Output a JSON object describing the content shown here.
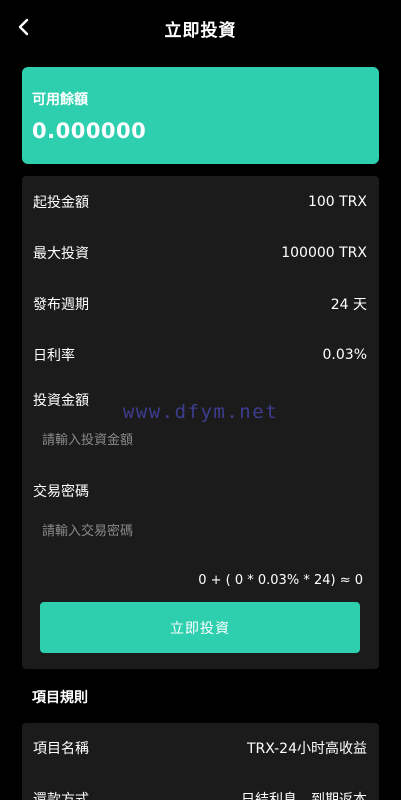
{
  "header": {
    "title": "立即投資",
    "back_icon": "chevron-left-icon"
  },
  "balance": {
    "label": "可用餘額",
    "value": "0.000000"
  },
  "details": [
    {
      "key": "起投金額",
      "value": "100 TRX"
    },
    {
      "key": "最大投資",
      "value": "100000 TRX"
    },
    {
      "key": "發布週期",
      "value": "24 天"
    },
    {
      "key": "日利率",
      "value": "0.03%"
    }
  ],
  "amount_field": {
    "label": "投資金額",
    "placeholder": "請輸入投資金額",
    "value": ""
  },
  "password_field": {
    "label": "交易密碼",
    "placeholder": "請輸入交易密碼",
    "value": ""
  },
  "formula": "0 + ( 0 * 0.03% * 24) ≈ 0",
  "submit_label": "立即投資",
  "watermark": "www.dfym.net",
  "rules": {
    "title": "項目規則",
    "items": [
      {
        "key": "項目名稱",
        "value": "TRX-24小时高收益"
      },
      {
        "key": "還款方式",
        "value": "日結利息，到期返本"
      }
    ]
  },
  "colors": {
    "accent": "#2ecfaf",
    "background": "#000000",
    "card": "#1b1b1b",
    "watermark": "#3d3d8f"
  }
}
